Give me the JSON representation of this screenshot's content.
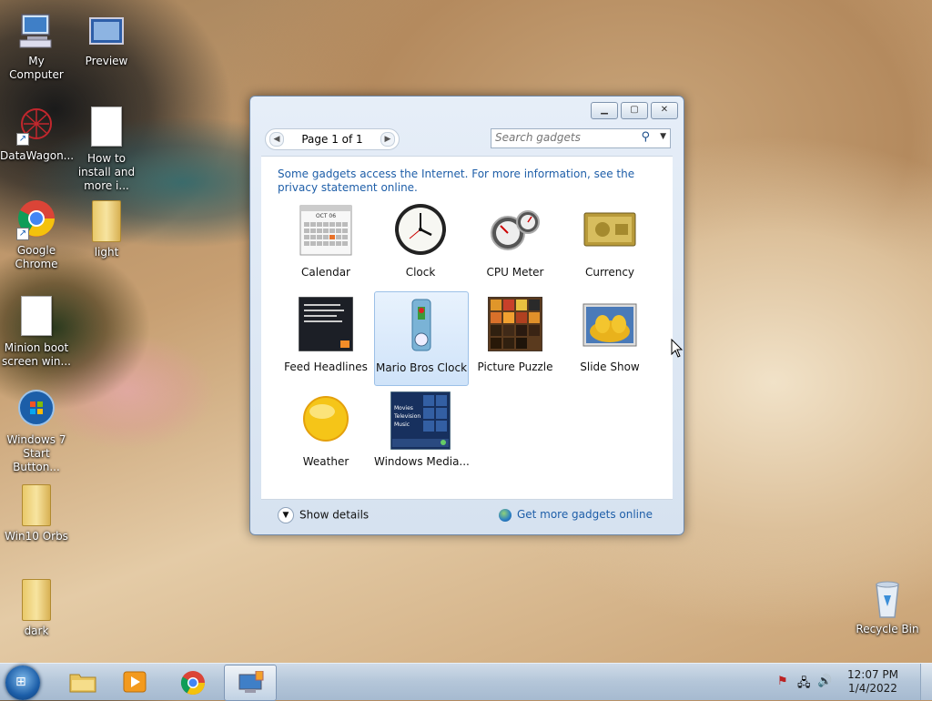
{
  "desktop": {
    "icons": [
      {
        "label": "My Computer",
        "icon": "computer-icon"
      },
      {
        "label": "Preview",
        "icon": "preview-icon"
      },
      {
        "label": "DataWagon...",
        "icon": "datawagon-icon"
      },
      {
        "label": "How to install and more i...",
        "icon": "document-icon"
      },
      {
        "label": "Google Chrome",
        "icon": "chrome-icon"
      },
      {
        "label": "light",
        "icon": "folder-icon"
      },
      {
        "label": "Minion boot screen win...",
        "icon": "document-icon"
      },
      {
        "label": "Windows 7 Start Button...",
        "icon": "windows-orb-icon"
      },
      {
        "label": "Win10 Orbs",
        "icon": "folder-icon"
      },
      {
        "label": "dark",
        "icon": "folder-icon"
      },
      {
        "label": "Recycle Bin",
        "icon": "recycle-bin-icon"
      }
    ]
  },
  "gadgets_window": {
    "pager_label": "Page 1 of 1",
    "search_placeholder": "Search gadgets",
    "notice": "Some gadgets access the Internet.  For more information, see the privacy statement online.",
    "gadgets": [
      {
        "name": "Calendar"
      },
      {
        "name": "Clock"
      },
      {
        "name": "CPU Meter"
      },
      {
        "name": "Currency"
      },
      {
        "name": "Feed Headlines"
      },
      {
        "name": "Mario Bros Clock",
        "selected": true
      },
      {
        "name": "Picture Puzzle"
      },
      {
        "name": "Slide Show"
      },
      {
        "name": "Weather"
      },
      {
        "name": "Windows Media..."
      }
    ],
    "calendar_month": "OCT 06",
    "media_lines": [
      "Movies",
      "Television",
      "Music"
    ],
    "show_details_label": "Show details",
    "get_more_label": "Get more gadgets online"
  },
  "taskbar": {
    "time": "12:07 PM",
    "date": "1/4/2022"
  }
}
